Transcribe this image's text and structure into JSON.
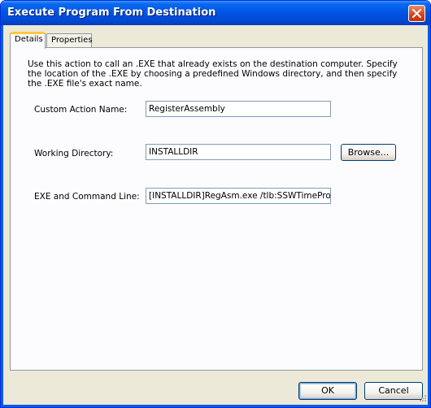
{
  "window": {
    "title": "Execute Program From Destination"
  },
  "tabs": [
    {
      "label": "Details",
      "selected": true
    },
    {
      "label": "Properties",
      "selected": false
    }
  ],
  "details": {
    "description": "Use this action to call an .EXE that already exists on the destination computer. Specify the location of the .EXE by choosing a predefined Windows directory, and then specify the .EXE file's exact name.",
    "custom_action_name": {
      "label": "Custom Action Name:",
      "value": "RegisterAssembly"
    },
    "working_directory": {
      "label": "Working Directory:",
      "value": "INSTALLDIR",
      "browse_label": "Browse..."
    },
    "exe_command_line": {
      "label": "EXE and Command Line:",
      "value": "[INSTALLDIR]RegAsm.exe /tlb:SSWTimeProS"
    }
  },
  "buttons": {
    "ok": "OK",
    "cancel": "Cancel"
  },
  "icons": {
    "close": "close-icon",
    "resize": "resize-grip-icon"
  },
  "colors": {
    "titlebar": "#0055E5",
    "tab_highlight": "#FFC83C",
    "dialog_bg": "#ECE9D8"
  }
}
